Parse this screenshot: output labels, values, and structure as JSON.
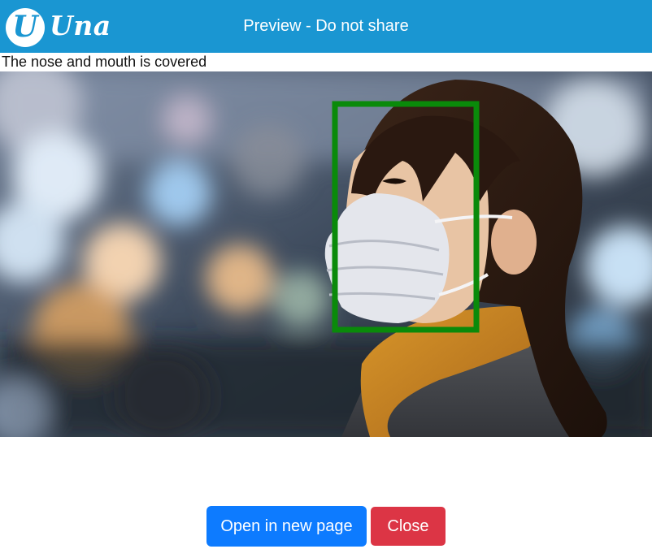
{
  "header": {
    "logo_mark": "U",
    "logo_text": "Una",
    "title": "Preview - Do not share"
  },
  "result": {
    "caption": "The nose and mouth is covered",
    "detection_color": "#0a8a0a"
  },
  "actions": {
    "open_label": "Open in new page",
    "close_label": "Close"
  },
  "colors": {
    "header_bg": "#1a96d2",
    "primary": "#0d7bff",
    "danger": "#dc3545"
  }
}
